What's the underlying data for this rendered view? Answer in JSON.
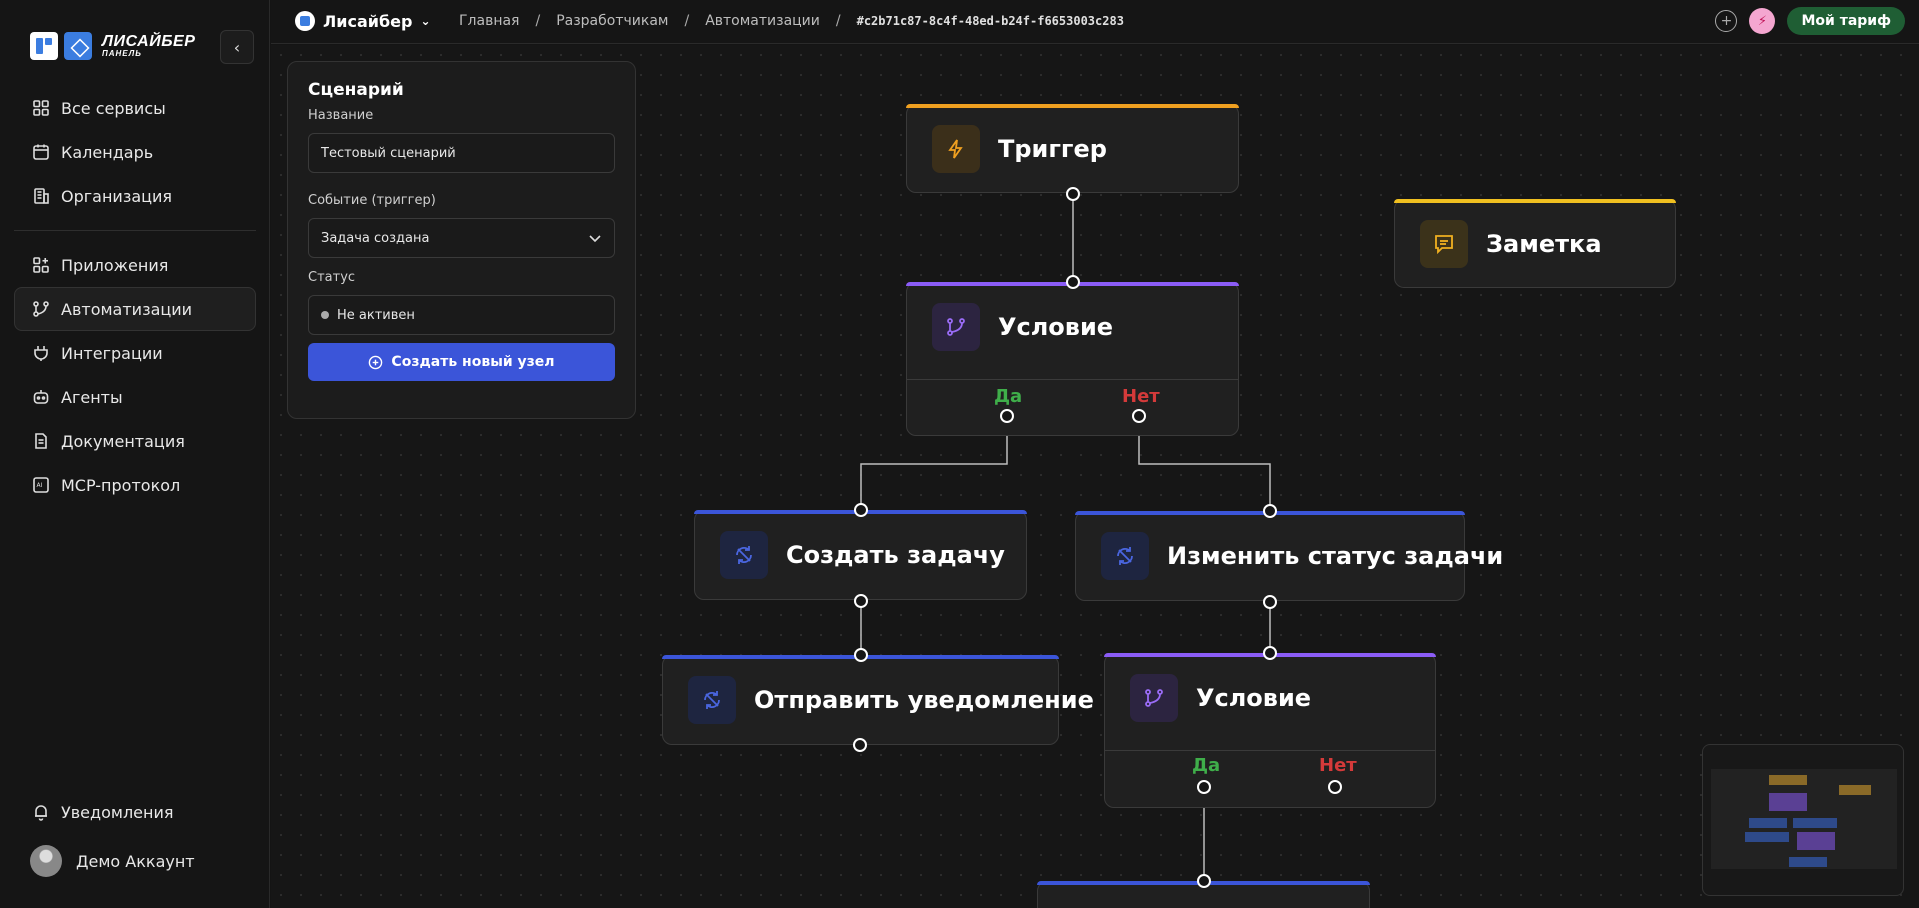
{
  "brand": {
    "line1": "ЛИСАЙБЕР",
    "line2": "ПАНЕЛЬ"
  },
  "sidebar": {
    "items_top": [
      {
        "label": "Все сервисы",
        "icon": "grid-icon"
      },
      {
        "label": "Календарь",
        "icon": "calendar-icon"
      },
      {
        "label": "Организация",
        "icon": "building-icon"
      }
    ],
    "items_main": [
      {
        "label": "Приложения",
        "icon": "apps-icon"
      },
      {
        "label": "Автоматизации",
        "icon": "workflow-icon",
        "active": true
      },
      {
        "label": "Интеграции",
        "icon": "plug-icon"
      },
      {
        "label": "Агенты",
        "icon": "bot-icon"
      },
      {
        "label": "Документация",
        "icon": "document-icon"
      },
      {
        "label": "MCP-протокол",
        "icon": "ai-icon"
      }
    ],
    "notifications": "Уведомления",
    "user": "Демо Аккаунт"
  },
  "header": {
    "workspace": "Лисайбер",
    "breadcrumbs": [
      "Главная",
      "Разработчикам",
      "Автоматизации"
    ],
    "id": "#c2b71c87-8c4f-48ed-b24f-f6653003c283",
    "plan_button": "Мой тариф"
  },
  "panel": {
    "title": "Сценарий",
    "name_label": "Название",
    "name_value": "Тестовый сценарий",
    "event_label": "Событие (триггер)",
    "event_value": "Задача создана",
    "status_label": "Статус",
    "status_value": "Не активен",
    "create_button": "Создать новый узел"
  },
  "nodes": {
    "trigger": "Триггер",
    "note": "Заметка",
    "condition1": "Условие",
    "create_task": "Создать задачу",
    "change_status": "Изменить статус задачи",
    "send_notification": "Отправить уведомление",
    "condition2": "Условие",
    "yes": "Да",
    "no": "Нет"
  },
  "colors": {
    "trigger": "#f0a020",
    "condition": "#8b5cf6",
    "action": "#3b55d9",
    "yes": "#3fae4a",
    "no": "#d43a3a",
    "plan_button": "#1f5e34"
  }
}
